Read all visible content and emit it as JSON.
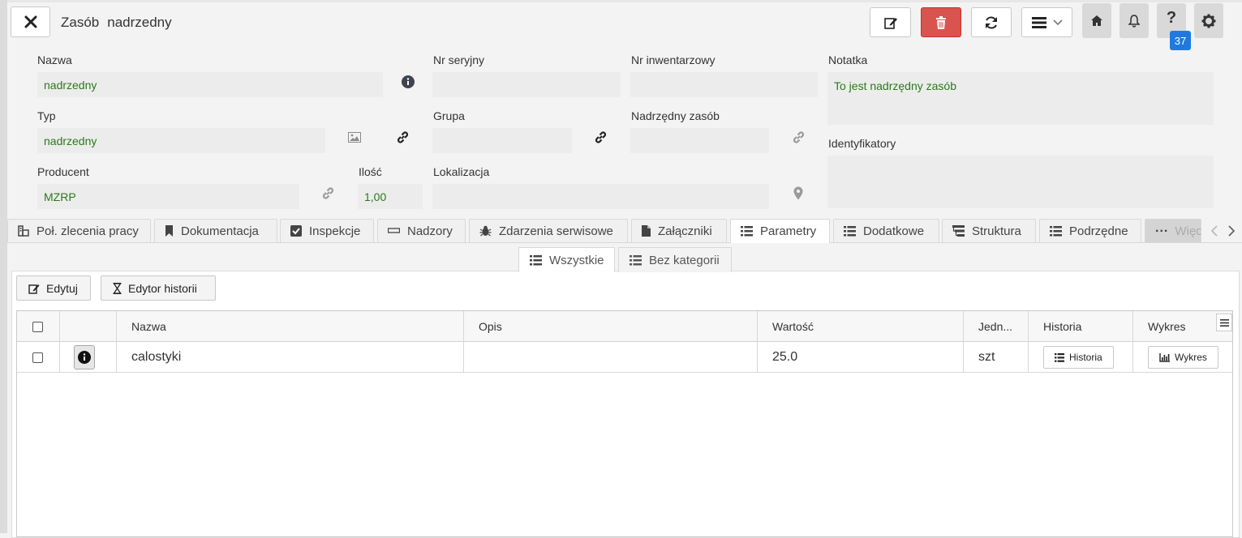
{
  "header": {
    "title_part1": "Zasób",
    "title_part2": "nadrzedny",
    "notifications_badge": "37",
    "icons": [
      "close-icon",
      "edit-icon",
      "trash-icon",
      "refresh-icon",
      "menu-icon",
      "chevron-down-icon",
      "home-icon",
      "bell-icon",
      "question-icon",
      "gear-icon"
    ],
    "colors": {
      "delete": "#d9534f",
      "badge": "#1f7ae0"
    }
  },
  "form": {
    "nazwa": {
      "label": "Nazwa",
      "value": "nadrzedny"
    },
    "nr_seryjny": {
      "label": "Nr seryjny",
      "value": ""
    },
    "nr_inwentarzowy": {
      "label": "Nr inwentarzowy",
      "value": ""
    },
    "notatka": {
      "label": "Notatka",
      "value": "To jest nadrzędny zasób"
    },
    "typ": {
      "label": "Typ",
      "value": "nadrzedny"
    },
    "grupa": {
      "label": "Grupa",
      "value": ""
    },
    "nadrzedny_zasob": {
      "label": "Nadrzędny zasób",
      "value": ""
    },
    "identyfikatory": {
      "label": "Identyfikatory",
      "value": ""
    },
    "producent": {
      "label": "Producent",
      "value": "MZRP"
    },
    "ilosc": {
      "label": "Ilość",
      "value": "1,00"
    },
    "lokalizacja": {
      "label": "Lokalizacja",
      "value": ""
    },
    "value_color": "#2a7a17"
  },
  "tabs": [
    {
      "label": "Poł. zlecenia pracy",
      "icon": "work-order-icon"
    },
    {
      "label": "Dokumentacja",
      "icon": "bookmark-icon"
    },
    {
      "label": "Inspekcje",
      "icon": "checkbox-icon"
    },
    {
      "label": "Nadzory",
      "icon": "minus-icon"
    },
    {
      "label": "Zdarzenia serwisowe",
      "icon": "bug-icon"
    },
    {
      "label": "Załączniki",
      "icon": "file-icon"
    },
    {
      "label": "Parametry",
      "icon": "list-icon",
      "active": true
    },
    {
      "label": "Dodatkowe",
      "icon": "list-icon"
    },
    {
      "label": "Struktura",
      "icon": "structure-icon"
    },
    {
      "label": "Podrzędne",
      "icon": "list-icon"
    },
    {
      "label": "Więcej",
      "icon": "ellipsis-icon"
    }
  ],
  "subtabs": [
    {
      "label": "Wszystkie",
      "active": true
    },
    {
      "label": "Bez kategorii"
    }
  ],
  "toolbar": {
    "edit_label": "Edytuj",
    "history_editor_label": "Edytor historii"
  },
  "grid": {
    "columns": [
      "",
      "",
      "Nazwa",
      "Opis",
      "Wartość",
      "Jedn...",
      "Historia",
      "Wykres"
    ],
    "rows": [
      {
        "nazwa": "calostyki",
        "opis": "",
        "wartosc": "25.0",
        "jednostka": "szt",
        "historia_btn": "Historia",
        "wykres_btn": "Wykres"
      }
    ]
  }
}
